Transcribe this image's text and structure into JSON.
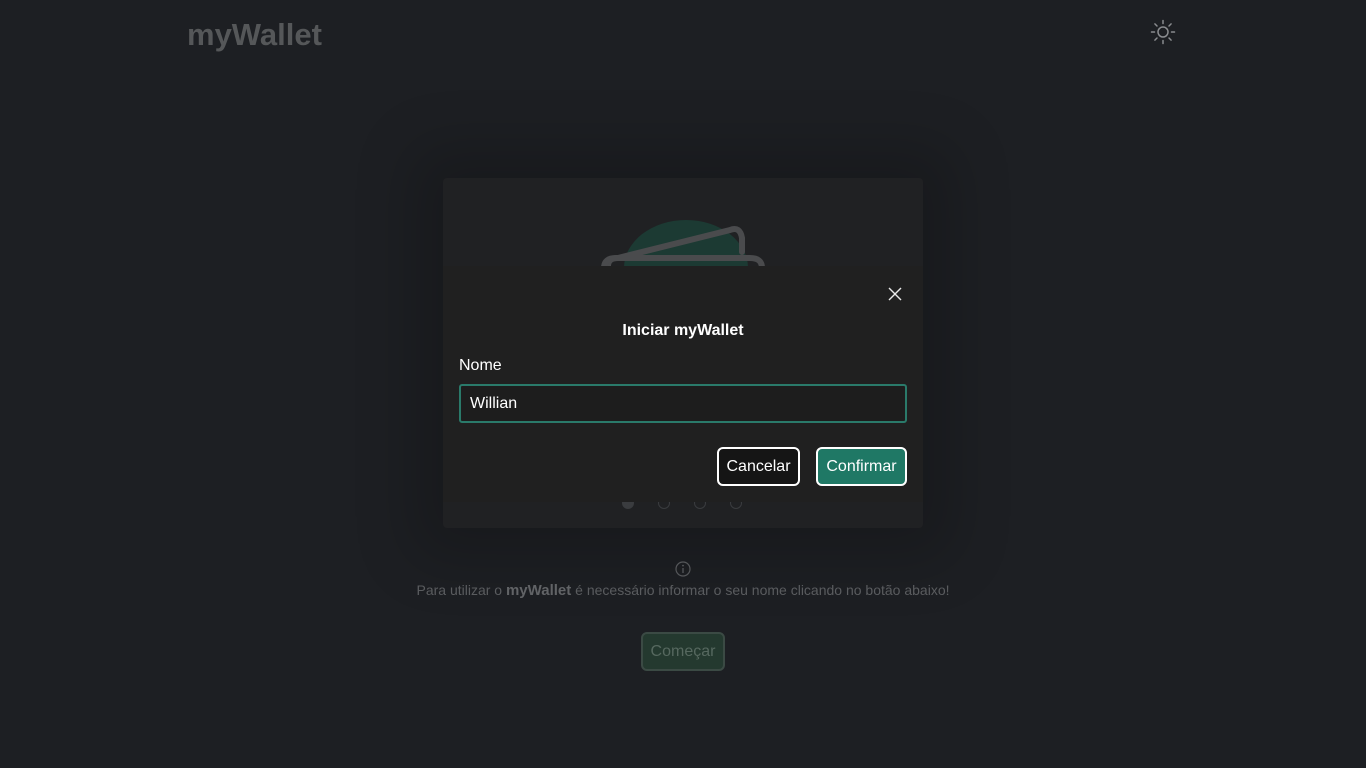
{
  "header": {
    "logo": "myWallet",
    "theme_icon": "sun-icon"
  },
  "background": {
    "illustration": "wallet-illustration",
    "carousel_dots": 4,
    "active_dot": 1,
    "info_icon": "info-icon",
    "info_prefix": "Para utilizar o ",
    "info_brand": "myWallet",
    "info_suffix": " é necessário informar o seu nome clicando no botão abaixo!",
    "start_label": "Começar"
  },
  "modal": {
    "title": "Iniciar myWallet",
    "close_icon": "close-icon",
    "name_label": "Nome",
    "name_value": "Willian",
    "cancel_label": "Cancelar",
    "confirm_label": "Confirmar"
  },
  "colors": {
    "background": "#1d1f23",
    "modal": "#202020",
    "accent": "#1f7865",
    "input_border": "#2a7a6a"
  }
}
